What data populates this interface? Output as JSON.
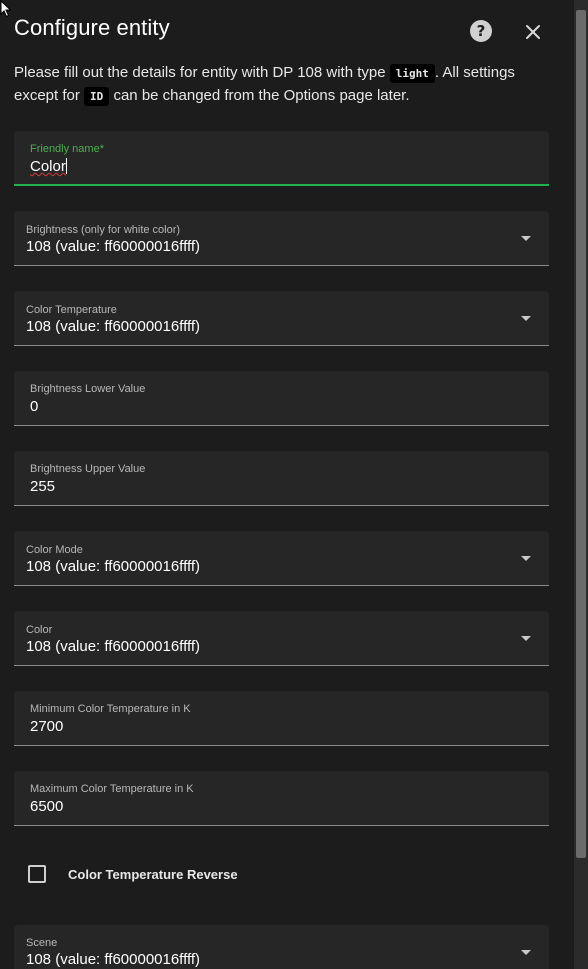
{
  "dialog": {
    "title": "Configure entity",
    "description_before_type": "Please fill out the details for entity with DP 108 with type ",
    "type_code": "light",
    "description_after_type": ". All settings except for ",
    "id_code": "ID",
    "description_end": " can be changed from the Options page later.",
    "help_icon": "help-circle-icon",
    "close_icon": "close-icon"
  },
  "fields": {
    "friendly_name": {
      "label": "Friendly name*",
      "value": "Color"
    },
    "brightness": {
      "label": "Brightness (only for white color)",
      "value": "108 (value: ff60000016ffff)"
    },
    "color_temperature": {
      "label": "Color Temperature",
      "value": "108 (value: ff60000016ffff)"
    },
    "brightness_lower": {
      "label": "Brightness Lower Value",
      "value": "0"
    },
    "brightness_upper": {
      "label": "Brightness Upper Value",
      "value": "255"
    },
    "color_mode": {
      "label": "Color Mode",
      "value": "108 (value: ff60000016ffff)"
    },
    "color": {
      "label": "Color",
      "value": "108 (value: ff60000016ffff)"
    },
    "min_color_temp": {
      "label": "Minimum Color Temperature in K",
      "value": "2700"
    },
    "max_color_temp": {
      "label": "Maximum Color Temperature in K",
      "value": "6500"
    },
    "color_temp_reverse": {
      "label": "Color Temperature Reverse",
      "checked": false
    },
    "scene": {
      "label": "Scene",
      "value": "108 (value: ff60000016ffff)"
    }
  },
  "colors": {
    "accent": "#22b14c",
    "background": "#1c1c1c",
    "field_background": "#262626"
  }
}
